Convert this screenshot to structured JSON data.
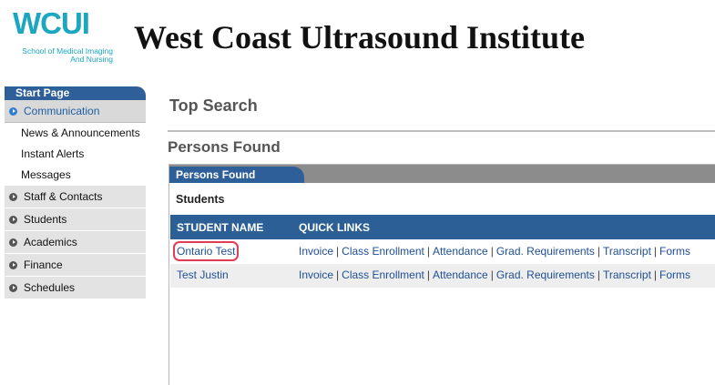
{
  "header": {
    "logo_mark": "WCUI",
    "logo_sub_line1": "School of Medical Imaging",
    "logo_sub_line2": "And Nursing",
    "site_title": "West Coast Ultrasound Institute"
  },
  "sidebar": {
    "start_tab": "Start Page",
    "sections": [
      {
        "label": "Communication",
        "active": true,
        "items": [
          "News & Announcements",
          "Instant Alerts",
          "Messages"
        ]
      },
      {
        "label": "Staff & Contacts"
      },
      {
        "label": "Students"
      },
      {
        "label": "Academics"
      },
      {
        "label": "Finance"
      },
      {
        "label": "Schedules"
      }
    ]
  },
  "main": {
    "page_heading": "Top Search",
    "sub_heading": "Persons Found",
    "panel_tab": "Persons Found",
    "panel_label": "Students",
    "columns": {
      "name": "STUDENT NAME",
      "links": "QUICK LINKS"
    },
    "rows": [
      {
        "name": "Ontario Test",
        "links": [
          "Invoice",
          "Class Enrollment",
          "Attendance",
          "Grad. Requirements",
          "Transcript",
          "Forms"
        ]
      },
      {
        "name": "Test Justin",
        "links": [
          "Invoice",
          "Class Enrollment",
          "Attendance",
          "Grad. Requirements",
          "Transcript",
          "Forms"
        ]
      }
    ]
  },
  "colors": {
    "brand_teal": "#1aa7bf",
    "nav_blue": "#2f5f99",
    "link_blue": "#1f4e96",
    "highlight_red": "#e23b55"
  }
}
